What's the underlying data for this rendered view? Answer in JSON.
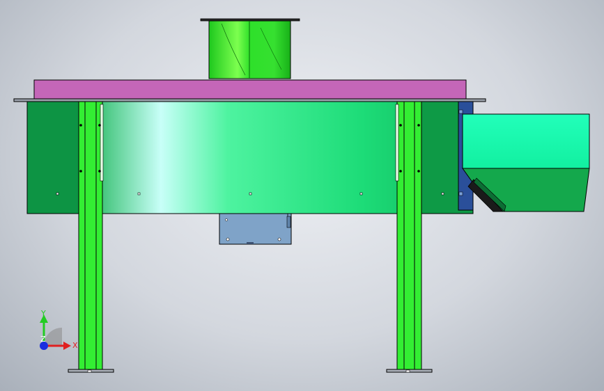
{
  "viewport": {
    "background": "#c8ccd3",
    "colors": {
      "outline": "#000000",
      "housing_green": "#18a84a",
      "housing_highlight": "#c6fff7",
      "housing_dark": "#0a8a40",
      "outlet_duct_green": "#22d02a",
      "top_plate_magenta": "#c466b8",
      "leg_green": "#33ee33",
      "motor_plate_blue": "#7fa3c8",
      "side_panel_blue": "#2a4f9a",
      "hopper_cyan": "#1fffb0",
      "hopper_green": "#14a84c"
    }
  },
  "triad": {
    "x_label": "X",
    "y_label": "Y",
    "z_label": "Z",
    "x_color": "#e02020",
    "y_color": "#22cc22",
    "z_color": "#1a2ee0"
  }
}
